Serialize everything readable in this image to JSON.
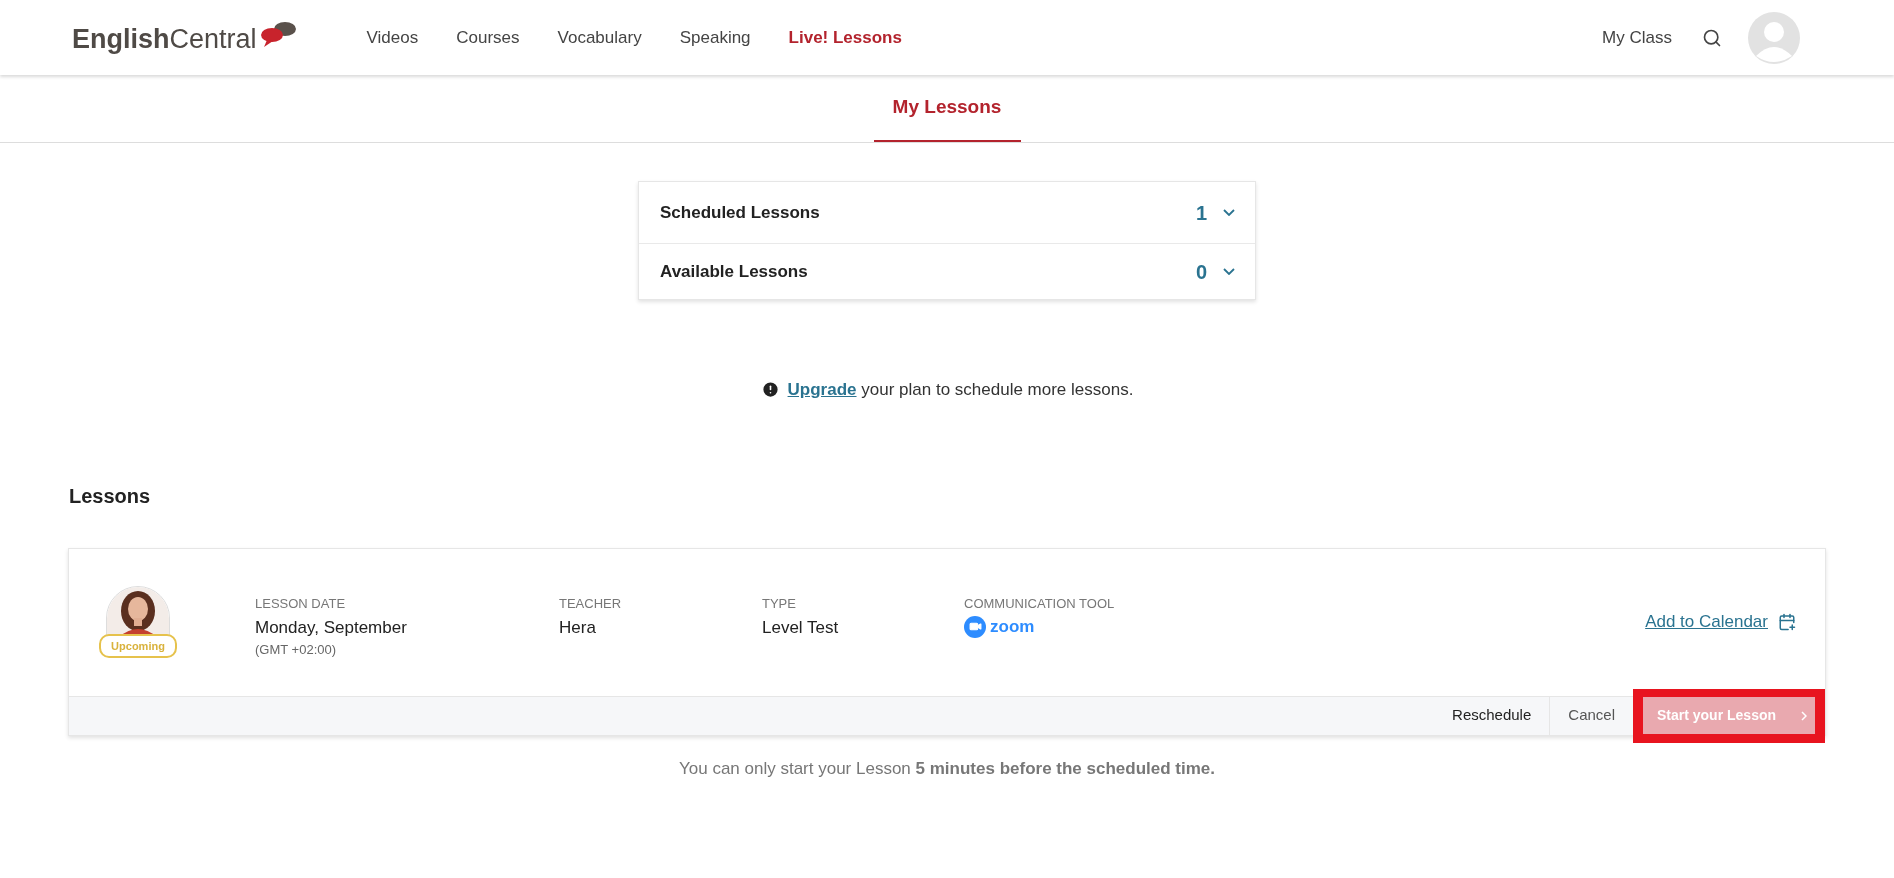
{
  "header": {
    "logo": {
      "part_1": "English",
      "part_2": "Central"
    },
    "nav": [
      {
        "label": "Videos",
        "selected": false
      },
      {
        "label": "Courses",
        "selected": false
      },
      {
        "label": "Vocabulary",
        "selected": false
      },
      {
        "label": "Speaking",
        "selected": false
      },
      {
        "label": "Live! Lessons",
        "selected": true
      }
    ],
    "my_class": "My Class"
  },
  "tabs": [
    {
      "label": "My Lessons",
      "selected": true
    }
  ],
  "accordion": [
    {
      "title": "Scheduled Lessons",
      "count": "1",
      "expanded": false
    },
    {
      "title": "Available Lessons",
      "count": "0",
      "expanded": false
    }
  ],
  "notice": {
    "link": "Upgrade",
    "text": "your plan to schedule more lessons."
  },
  "lessons": {
    "heading": "Lessons",
    "items": [
      {
        "status": "Upcoming",
        "fields": [
          {
            "kind": "text",
            "label": "LESSON DATE",
            "value": "Monday, September",
            "note": "(GMT +02:00)"
          },
          {
            "kind": "text",
            "label": "TEACHER",
            "value": "Hera"
          },
          {
            "kind": "text",
            "label": "TYPE",
            "value": "Level Test"
          },
          {
            "kind": "tool",
            "label": "COMMUNICATION TOOL",
            "value": "zoom"
          }
        ],
        "calendar_link": "Add to Calendar",
        "actions": [
          {
            "kind": "plain",
            "label": "Reschedule",
            "disabled": false
          },
          {
            "kind": "plain",
            "label": "Cancel",
            "disabled": false
          },
          {
            "kind": "primary",
            "label": "Start your Lesson",
            "disabled": true,
            "highlighted": true
          }
        ]
      }
    ],
    "footnote": "You can only start your Lesson **5 minutes before the scheduled time.**"
  }
}
